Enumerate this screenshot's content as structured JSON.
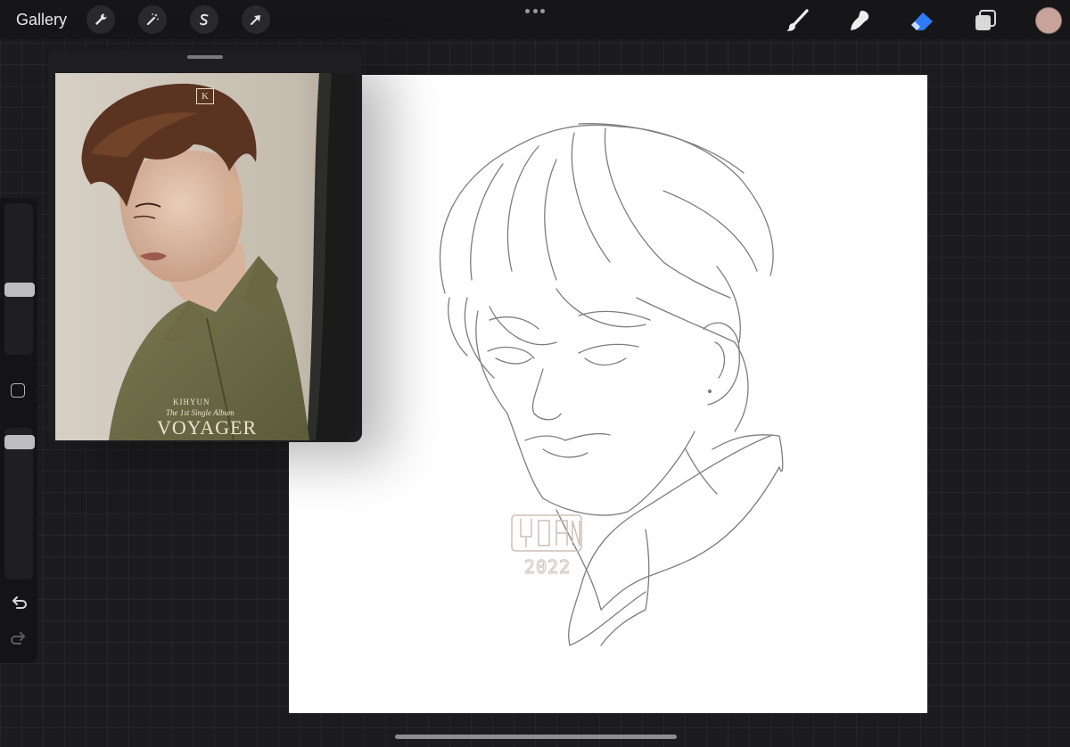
{
  "toolbar": {
    "gallery_label": "Gallery",
    "left_tools": [
      "wrench-icon",
      "magic-wand-icon",
      "selection-icon",
      "transform-arrow-icon"
    ],
    "right_tools": [
      "brush-icon",
      "smudge-icon",
      "eraser-icon",
      "layers-icon"
    ],
    "active_tool": "eraser",
    "active_tool_color": "#2f7bf6",
    "current_color": "#c9a29a"
  },
  "reference": {
    "photo_logo": "K",
    "artist": "KIHYUN",
    "subtitle": "The 1st Single Album",
    "album_title": "VOYAGER"
  },
  "canvas": {
    "signature_name": "YOAN",
    "signature_year": "2022"
  },
  "sidebar": {
    "brush_size": 0.42,
    "opacity": 0.95
  }
}
